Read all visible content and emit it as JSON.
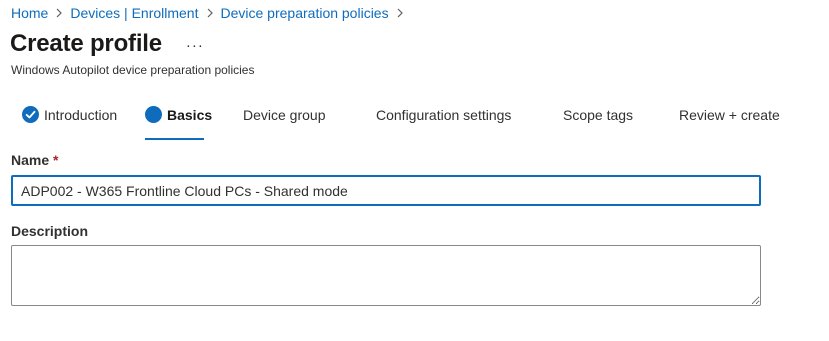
{
  "breadcrumb": {
    "items": [
      "Home",
      "Devices | Enrollment",
      "Device preparation policies"
    ]
  },
  "header": {
    "title": "Create profile",
    "more_label": "···",
    "subtitle": "Windows Autopilot device preparation policies"
  },
  "tabs": [
    {
      "label": "Introduction",
      "state": "completed"
    },
    {
      "label": "Basics",
      "state": "active"
    },
    {
      "label": "Device group",
      "state": "inactive"
    },
    {
      "label": "Configuration settings",
      "state": "inactive"
    },
    {
      "label": "Scope tags",
      "state": "inactive"
    },
    {
      "label": "Review + create",
      "state": "inactive"
    }
  ],
  "form": {
    "name_label": "Name",
    "required_marker": "*",
    "name_value": "ADP002 - W365 Frontline Cloud PCs - Shared mode",
    "description_label": "Description",
    "description_value": ""
  },
  "colors": {
    "accent": "#0f6cbd",
    "text": "#323130",
    "required": "#a4262c"
  },
  "icons": {
    "completed_tab": "checkmark-circle-icon",
    "active_tab": "filled-circle-icon",
    "breadcrumb_separator": "chevron-right-icon",
    "more": "more-ellipsis-icon"
  }
}
